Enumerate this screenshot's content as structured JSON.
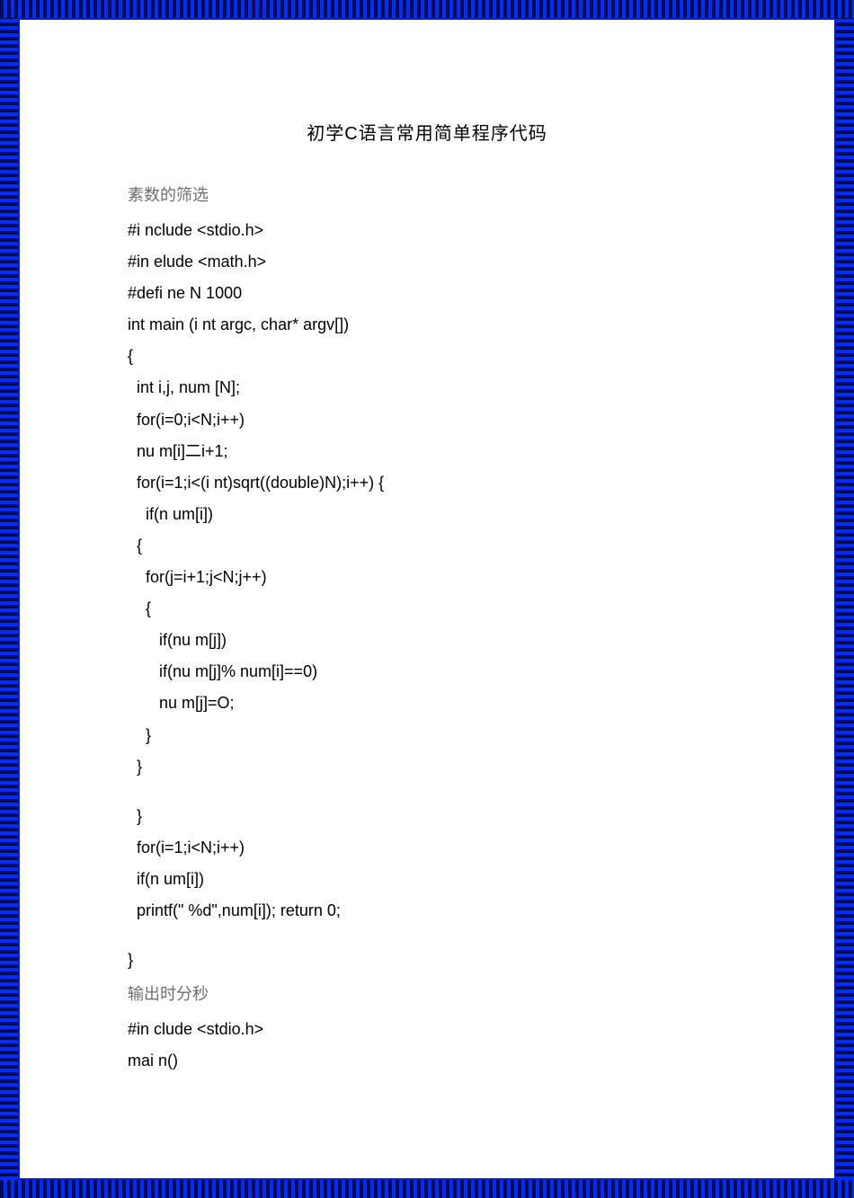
{
  "title": "初学C语言常用简单程序代码",
  "section1": "素数的筛选",
  "lines1": [
    "#i nclude <stdio.h>",
    "#in elude <math.h>",
    "#defi ne N 1000",
    "int main (i nt argc, char* argv[])",
    "{",
    "  int i,j, num [N];",
    "  for(i=0;i<N;i++)",
    "  nu m[i]二i+1;",
    "  for(i=1;i<(i nt)sqrt((double)N);i++) {",
    "    if(n um[i])",
    "  {",
    "    for(j=i+1;j<N;j++)",
    "    {",
    "       if(nu m[j])",
    "       if(nu m[j]% num[i]==0)",
    "       nu m[j]=O;",
    "    }",
    "  }",
    "",
    "  }",
    "  for(i=1;i<N;i++)",
    "  if(n um[i])",
    "  printf(\" %d\",num[i]); return 0;",
    "",
    "}"
  ],
  "section2": "输出时分秒",
  "lines2": [
    "#in clude <stdio.h>",
    "mai n()"
  ]
}
